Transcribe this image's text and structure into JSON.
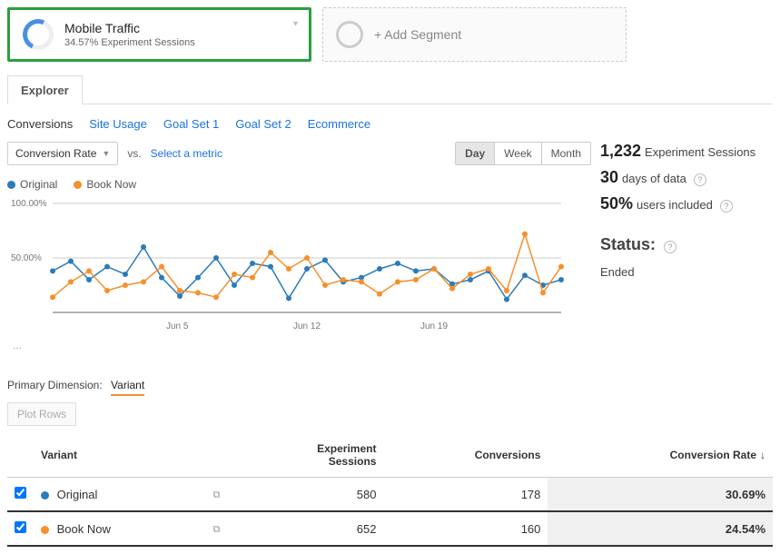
{
  "segments": {
    "active": {
      "title": "Mobile Traffic",
      "subtitle": "34.57% Experiment Sessions"
    },
    "add_label": "+ Add Segment"
  },
  "tabs": {
    "explorer": "Explorer"
  },
  "subtabs": {
    "conversions": "Conversions",
    "site_usage": "Site Usage",
    "goal1": "Goal Set 1",
    "goal2": "Goal Set 2",
    "ecommerce": "Ecommerce"
  },
  "toolbar": {
    "metric1": "Conversion Rate",
    "vs": "vs.",
    "metric2_placeholder": "Select a metric",
    "gran": {
      "day": "Day",
      "week": "Week",
      "month": "Month"
    }
  },
  "legend": {
    "s1": "Original",
    "s2": "Book Now"
  },
  "summary": {
    "sessions_value": "1,232",
    "sessions_label": "Experiment Sessions",
    "days_value": "30",
    "days_label": "days of data",
    "users_value": "50%",
    "users_label": "users included",
    "status_heading": "Status:",
    "status_value": "Ended"
  },
  "dimension": {
    "label": "Primary Dimension:",
    "value": "Variant"
  },
  "plot_rows": "Plot Rows",
  "table": {
    "headers": {
      "variant": "Variant",
      "sessions": "Experiment\nSessions",
      "conversions": "Conversions",
      "rate": "Conversion Rate"
    },
    "rows": [
      {
        "color": "blue",
        "name": "Original",
        "sessions": "580",
        "conversions": "178",
        "rate": "30.69%"
      },
      {
        "color": "orange",
        "name": "Book Now",
        "sessions": "652",
        "conversions": "160",
        "rate": "24.54%"
      }
    ]
  },
  "chart_data": {
    "type": "line",
    "ylabel": "",
    "ylim": [
      0,
      100
    ],
    "yticks": [
      "50.00%",
      "100.00%"
    ],
    "xticks": [
      "Jun 5",
      "Jun 12",
      "Jun 19"
    ],
    "x_start_label": "…",
    "series": [
      {
        "name": "Original",
        "color": "#2b7bb9",
        "values": [
          38,
          47,
          30,
          42,
          35,
          60,
          32,
          15,
          32,
          50,
          25,
          45,
          42,
          13,
          40,
          48,
          28,
          32,
          40,
          45,
          38,
          40,
          26,
          30,
          38,
          12,
          34,
          25,
          30
        ]
      },
      {
        "name": "Book Now",
        "color": "#f5902c",
        "values": [
          14,
          28,
          38,
          20,
          25,
          28,
          42,
          20,
          18,
          14,
          35,
          32,
          55,
          40,
          50,
          25,
          30,
          28,
          17,
          28,
          30,
          40,
          22,
          35,
          40,
          20,
          72,
          18,
          42
        ]
      }
    ]
  }
}
